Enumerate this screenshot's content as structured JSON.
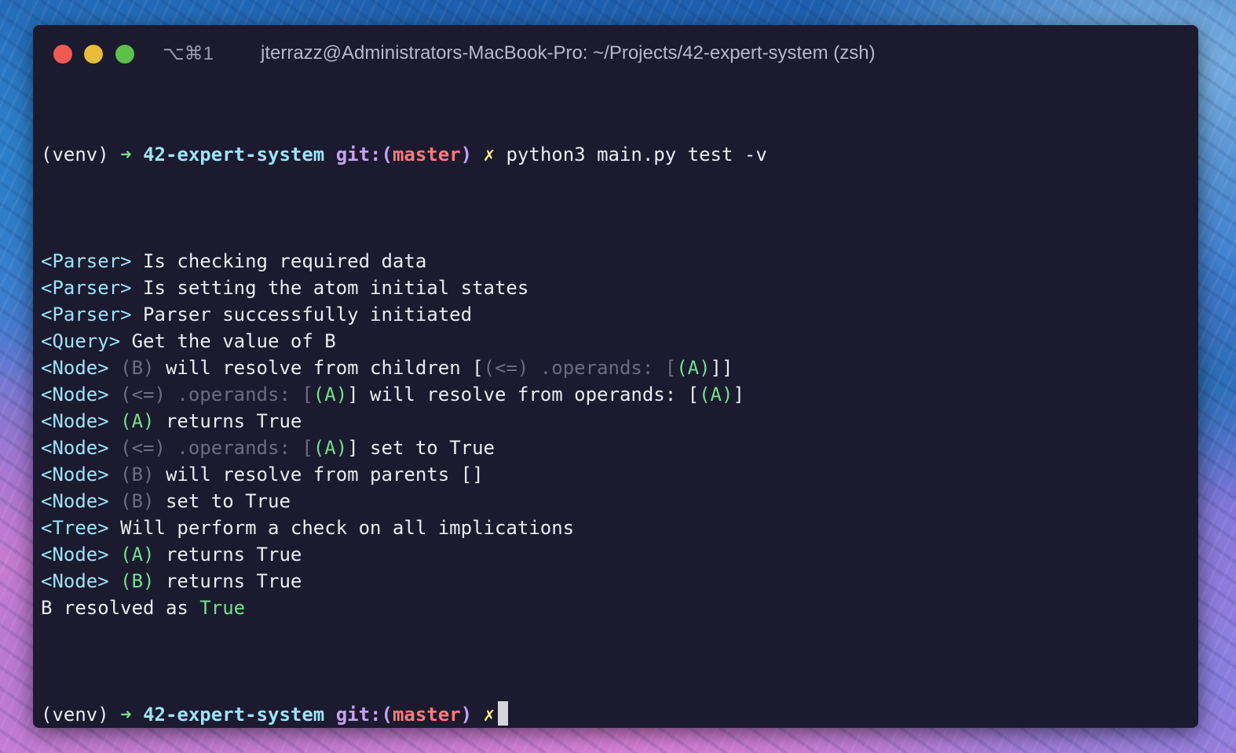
{
  "window": {
    "shortcut": "⌥⌘1",
    "title": "jterrazz@Administrators-MacBook-Pro: ~/Projects/42-expert-system (zsh)"
  },
  "terminal": {
    "prompt": {
      "venv": "(venv)",
      "arrow": "➜",
      "dir": "42-expert-system",
      "git_prefix": "git:(",
      "branch": "master",
      "git_suffix": ")",
      "dirty": "✗"
    },
    "command": "python3 main.py test -v",
    "lines": [
      [
        {
          "t": "<Parser>",
          "c": "cyan"
        },
        {
          "t": " Is checking required data",
          "c": "default"
        }
      ],
      [
        {
          "t": "<Parser>",
          "c": "cyan"
        },
        {
          "t": " Is setting the atom initial states",
          "c": "default"
        }
      ],
      [
        {
          "t": "<Parser>",
          "c": "cyan"
        },
        {
          "t": " Parser successfully initiated",
          "c": "default"
        }
      ],
      [
        {
          "t": "<Query>",
          "c": "cyan"
        },
        {
          "t": " Get the value of B",
          "c": "default"
        }
      ],
      [
        {
          "t": "<Node>",
          "c": "cyan"
        },
        {
          "t": " ",
          "c": "default"
        },
        {
          "t": "(B)",
          "c": "gray"
        },
        {
          "t": " will resolve from children [",
          "c": "default"
        },
        {
          "t": "(<=) .operands: [",
          "c": "gray"
        },
        {
          "t": "(A)",
          "c": "green"
        },
        {
          "t": "]]",
          "c": "default"
        }
      ],
      [
        {
          "t": "<Node>",
          "c": "cyan"
        },
        {
          "t": " ",
          "c": "default"
        },
        {
          "t": "(<=) .operands: [",
          "c": "gray"
        },
        {
          "t": "(A)",
          "c": "green"
        },
        {
          "t": "] will resolve from operands: [",
          "c": "default"
        },
        {
          "t": "(A)",
          "c": "green"
        },
        {
          "t": "]",
          "c": "default"
        }
      ],
      [
        {
          "t": "<Node>",
          "c": "cyan"
        },
        {
          "t": " ",
          "c": "default"
        },
        {
          "t": "(A)",
          "c": "green"
        },
        {
          "t": " returns True",
          "c": "default"
        }
      ],
      [
        {
          "t": "<Node>",
          "c": "cyan"
        },
        {
          "t": " ",
          "c": "default"
        },
        {
          "t": "(<=) .operands: [",
          "c": "gray"
        },
        {
          "t": "(A)",
          "c": "green"
        },
        {
          "t": "] set to True",
          "c": "default"
        }
      ],
      [
        {
          "t": "<Node>",
          "c": "cyan"
        },
        {
          "t": " ",
          "c": "default"
        },
        {
          "t": "(B)",
          "c": "gray"
        },
        {
          "t": " will resolve from parents []",
          "c": "default"
        }
      ],
      [
        {
          "t": "<Node>",
          "c": "cyan"
        },
        {
          "t": " ",
          "c": "default"
        },
        {
          "t": "(B)",
          "c": "gray"
        },
        {
          "t": " set to True",
          "c": "default"
        }
      ],
      [
        {
          "t": "<Tree>",
          "c": "cyan"
        },
        {
          "t": " Will perform a check on all implications",
          "c": "default"
        }
      ],
      [
        {
          "t": "<Node>",
          "c": "cyan"
        },
        {
          "t": " ",
          "c": "default"
        },
        {
          "t": "(A)",
          "c": "green"
        },
        {
          "t": " returns True",
          "c": "default"
        }
      ],
      [
        {
          "t": "<Node>",
          "c": "cyan"
        },
        {
          "t": " ",
          "c": "default"
        },
        {
          "t": "(B)",
          "c": "green"
        },
        {
          "t": " returns True",
          "c": "default"
        }
      ],
      [
        {
          "t": "B resolved as ",
          "c": "default"
        },
        {
          "t": "True",
          "c": "green"
        }
      ]
    ]
  }
}
